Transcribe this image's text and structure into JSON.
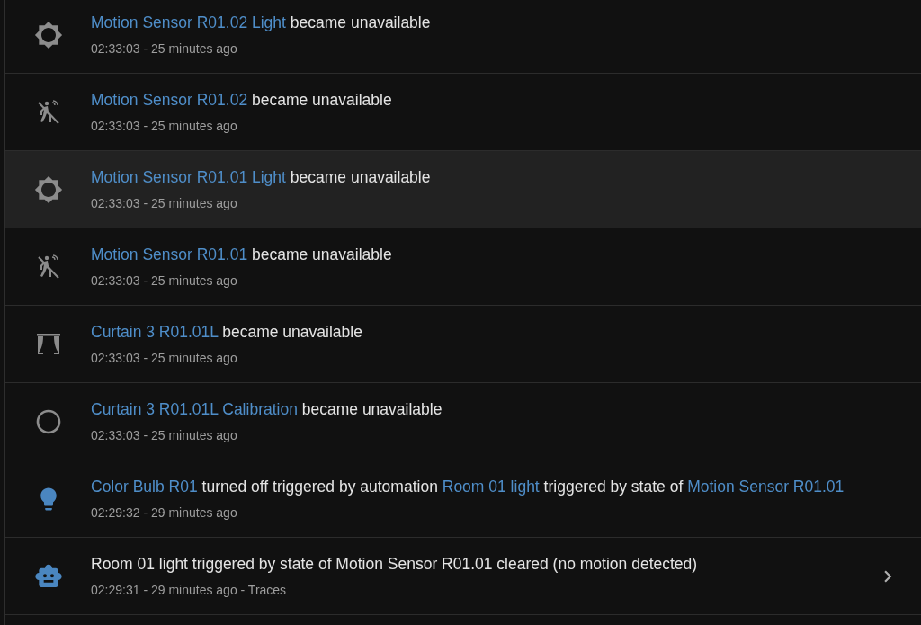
{
  "events": [
    {
      "kind": "brightness",
      "hovered": false,
      "message": [
        {
          "text": "Motion Sensor R01.02 Light",
          "link": true
        },
        {
          "text": " became unavailable",
          "link": false
        }
      ],
      "time": "02:33:03 - 25 minutes ago",
      "has_detail": false
    },
    {
      "kind": "motion-off",
      "hovered": false,
      "message": [
        {
          "text": "Motion Sensor R01.02",
          "link": true
        },
        {
          "text": " became unavailable",
          "link": false
        }
      ],
      "time": "02:33:03 - 25 minutes ago",
      "has_detail": false
    },
    {
      "kind": "brightness",
      "hovered": true,
      "message": [
        {
          "text": "Motion Sensor R01.01 Light",
          "link": true
        },
        {
          "text": " became unavailable",
          "link": false
        }
      ],
      "time": "02:33:03 - 25 minutes ago",
      "has_detail": false
    },
    {
      "kind": "motion-off",
      "hovered": false,
      "message": [
        {
          "text": "Motion Sensor R01.01",
          "link": true
        },
        {
          "text": " became unavailable",
          "link": false
        }
      ],
      "time": "02:33:03 - 25 minutes ago",
      "has_detail": false
    },
    {
      "kind": "curtains",
      "hovered": false,
      "message": [
        {
          "text": "Curtain 3 R01.01L",
          "link": true
        },
        {
          "text": " became unavailable",
          "link": false
        }
      ],
      "time": "02:33:03 - 25 minutes ago",
      "has_detail": false
    },
    {
      "kind": "circle",
      "hovered": false,
      "message": [
        {
          "text": "Curtain 3 R01.01L Calibration",
          "link": true
        },
        {
          "text": " became unavailable",
          "link": false
        }
      ],
      "time": "02:33:03 - 25 minutes ago",
      "has_detail": false
    },
    {
      "kind": "bulb",
      "hovered": false,
      "message": [
        {
          "text": "Color Bulb R01",
          "link": true
        },
        {
          "text": " turned off triggered by automation ",
          "link": false
        },
        {
          "text": "Room 01 light",
          "link": true
        },
        {
          "text": " triggered by state of ",
          "link": false
        },
        {
          "text": "Motion Sensor R01.01",
          "link": true
        }
      ],
      "time": "02:29:32 - 29 minutes ago",
      "has_detail": false
    },
    {
      "kind": "robot",
      "hovered": false,
      "message": [
        {
          "text": "Room 01 light triggered by state of Motion Sensor R01.01 cleared (no motion detected)",
          "link": false
        }
      ],
      "time": "02:29:31 - 29 minutes ago - Traces",
      "has_detail": true
    }
  ]
}
